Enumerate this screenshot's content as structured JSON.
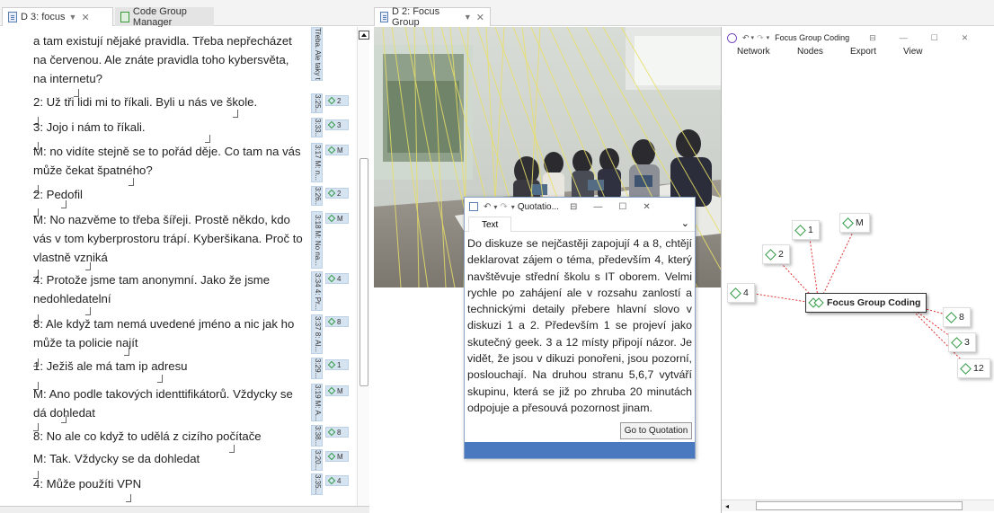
{
  "tabs_left": [
    {
      "label": "D 3: focus",
      "active": true
    },
    {
      "label": "Code Group Manager",
      "active": false
    }
  ],
  "tabs_mid": [
    {
      "label": "D 2: Focus Group",
      "active": false
    }
  ],
  "document": {
    "paragraphs": [
      "a tam existují nějaké pravidla. Třeba nepřecházet na červenou. Ale znáte pravidla toho kybersvěta, na internetu?",
      "2: Už tři lidi mi to říkali. Byli u nás ve škole.",
      "3: Jojo i nám to říkali.",
      "M: no vidíte stejně se to pořád děje. Co tam na vás může čekat špatného?",
      "2: Pedofil",
      "M: No nazvěme to třeba šířeji. Prostě někdo, kdo vás v tom kyberprostoru trápí. Kyberšikana. Proč to vlastně vzniká",
      "4: Protože jsme tam anonymní. Jako že jsme nedohledatelní",
      "8: Ale když tam nemá uvedené jméno a nic jak ho může ta policie najít",
      "1: Ježiš ale má tam ip adresu",
      "M: Ano podle takových identtifikátorů. Vždycky se dá dohledat",
      "8: No ale co když to udělá z cizího počítače",
      "M: Tak. Vždycky se da dohledat",
      "4: Může použíti VPN"
    ]
  },
  "margin": {
    "labels": [
      "Třeba. Ale taky t...",
      "3:25...",
      "3:33...",
      "3:17 M: n...",
      "3:26...",
      "3:18 M: No na...",
      "3:34 4: Pr...",
      "3:37 8: Al...",
      "3:29...",
      "3:19 M: A...",
      "3:38...",
      "3:20...",
      "3:35..."
    ],
    "codes": [
      "2",
      "3",
      "M",
      "2",
      "M",
      "4",
      "8",
      "1",
      "M",
      "8",
      "M",
      "4"
    ]
  },
  "quotation": {
    "title": "Quotatio...",
    "tab": "Text",
    "text": "Do diskuze se nejčastěji zapojují 4 a 8, chtějí deklarovat zájem o téma, především 4, který navštěvuje střední školu s IT oborem. Velmi rychle po zahájení ale v rozsahu zanlostí a technickými detaily přebere hlavní slovo v diskuzi 1 a 2. Především 1 se projeví jako skutečný geek. 3 a 12 místy připojí názor. Je vidět, že jsou v dikuzi ponořeni, jsou pozorní, poslouchají. Na druhou stranu 5,6,7 vytváří skupinu, která se již po zhruba 20 minutách odpojuje a přesouvá pozornost jinam.",
    "button": "Go to Quotation"
  },
  "network": {
    "title": "Focus Group Coding",
    "menu": [
      "Network",
      "Nodes",
      "Export",
      "View"
    ],
    "center": "Focus Group Coding",
    "nodes": [
      "1",
      "M",
      "2",
      "4",
      "8",
      "3",
      "12"
    ]
  },
  "colors": {
    "accent": "#4a79bf",
    "code_green": "#2e9a43",
    "link_red": "#e03030",
    "margin_blue": "#d6e3f1"
  }
}
